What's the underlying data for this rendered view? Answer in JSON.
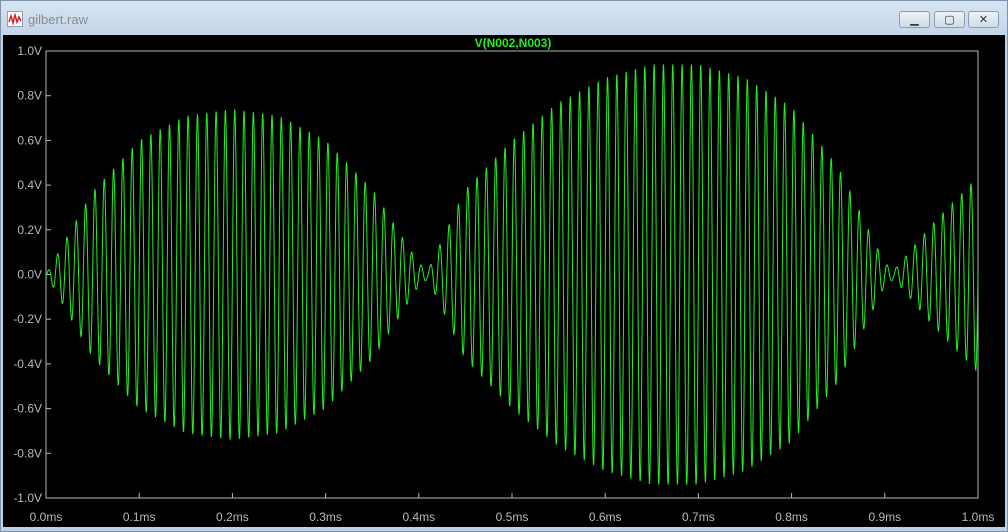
{
  "window": {
    "title": "gilbert.raw",
    "minimize_label": "▁",
    "maximize_label": "▢",
    "close_label": "✕",
    "icon": "waveform-icon"
  },
  "colors": {
    "trace": "#22ee22",
    "background": "#000000",
    "axis": "#b9b9b9"
  },
  "chart_data": {
    "type": "line",
    "title": "V(N002,N003)",
    "xlabel": "",
    "ylabel": "",
    "xlim": [
      0,
      1.0
    ],
    "ylim": [
      -1.0,
      1.0
    ],
    "x_unit": "ms",
    "y_unit": "V",
    "grid": false,
    "x_ticks": [
      0.0,
      0.1,
      0.2,
      0.3,
      0.4,
      0.5,
      0.6,
      0.7,
      0.8,
      0.9,
      1.0
    ],
    "x_tick_labels": [
      "0.0ms",
      "0.1ms",
      "0.2ms",
      "0.3ms",
      "0.4ms",
      "0.5ms",
      "0.6ms",
      "0.7ms",
      "0.8ms",
      "0.9ms",
      "1.0ms"
    ],
    "y_ticks": [
      1.0,
      0.8,
      0.6,
      0.4,
      0.2,
      0.0,
      -0.2,
      -0.4,
      -0.6,
      -0.8,
      -1.0
    ],
    "y_tick_labels": [
      "1.0V",
      "0.8V",
      "0.6V",
      "0.4V",
      "0.2V",
      "0.0V",
      "-0.2V",
      "-0.4V",
      "-0.6V",
      "-0.8V",
      "-1.0V"
    ],
    "series": [
      {
        "name": "V(N002,N003)",
        "carrier_cycles_per_ms": 100,
        "envelope": {
          "x": [
            0.0,
            0.05,
            0.1,
            0.15,
            0.2,
            0.25,
            0.3,
            0.35,
            0.4,
            0.41,
            0.45,
            0.5,
            0.55,
            0.6,
            0.65,
            0.7,
            0.75,
            0.8,
            0.85,
            0.9,
            0.91,
            0.95,
            1.0
          ],
          "y": [
            0.0,
            0.37,
            0.6,
            0.71,
            0.74,
            0.71,
            0.6,
            0.38,
            0.05,
            0.02,
            0.38,
            0.6,
            0.77,
            0.88,
            0.94,
            0.94,
            0.88,
            0.75,
            0.48,
            0.05,
            0.02,
            0.22,
            0.44
          ]
        }
      }
    ]
  }
}
